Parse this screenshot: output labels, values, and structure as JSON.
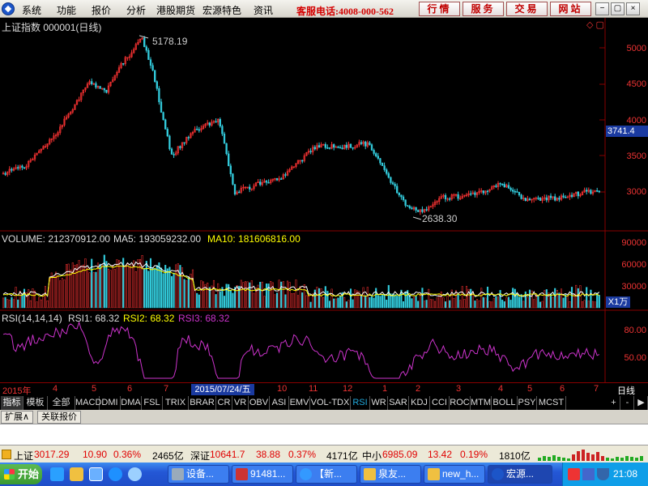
{
  "menu": {
    "items": [
      "系统",
      "功能",
      "报价",
      "分析",
      "港股期货",
      "宏源特色",
      "资讯"
    ],
    "hotline": "客服电话:4008-000-562",
    "buttons": [
      "行情",
      "服务",
      "交易",
      "网站"
    ],
    "window_controls": [
      "−",
      "▢",
      "×"
    ]
  },
  "main_chart": {
    "title": "上证指数 000001(日线)",
    "high_label": "5178.19",
    "low_label": "2638.30",
    "current_price_tag": "3741.4",
    "y_ticks": [
      "5000",
      "4500",
      "4000",
      "3500",
      "3000"
    ]
  },
  "volume_chart": {
    "label_volume": "VOLUME: 212370912.00",
    "label_ma5": "MA5: 193059232.00",
    "label_ma10": "MA10: 181606816.00",
    "y_ticks": [
      "90000",
      "60000",
      "30000"
    ],
    "unit": "X1万"
  },
  "rsi_chart": {
    "label_main": "RSI(14,14,14)",
    "label_rsi1": "RSI1: 68.32",
    "label_rsi2": "RSI2: 68.32",
    "label_rsi3": "RSI3: 68.32",
    "y_ticks": [
      "80.00",
      "50.00"
    ]
  },
  "time_axis": {
    "labels": [
      "2015年",
      "4",
      "5",
      "6",
      "7",
      "10",
      "11",
      "12",
      "1",
      "2",
      "3",
      "4",
      "5",
      "6",
      "7"
    ],
    "selected_date": "2015/07/24/五",
    "period": "日线"
  },
  "indicator_tabs": [
    "指标",
    "模板",
    "全部",
    "MACD",
    "DMI",
    "DMA",
    "FSL",
    "TRIX",
    "BRAR",
    "CR",
    "VR",
    "OBV",
    "ASI",
    "EMV",
    "VOL-TDX",
    "RSI",
    "WR",
    "SAR",
    "KDJ",
    "CCI",
    "ROC",
    "MTM",
    "BOLL",
    "PSY",
    "MCST"
  ],
  "tab_controls": [
    "+",
    "-",
    "▶"
  ],
  "expand_tabs": [
    "扩展∧",
    "关联报价"
  ],
  "status_bar": {
    "sh_name": "上证",
    "sh_value": "3017.29",
    "sh_change": "10.90",
    "sh_pct": "0.36%",
    "sh_amount": "2465亿",
    "sz_name": "深证",
    "sz_value": "10641.7",
    "sz_change": "38.88",
    "sz_pct": "0.37%",
    "sz_amount": "4171亿",
    "zx_name": "中小",
    "zx_value": "6985.09",
    "zx_change": "13.42",
    "zx_pct": "0.19%",
    "zx_amount": "1810亿"
  },
  "taskbar": {
    "start_label": "开始",
    "tasks": [
      "设备...",
      "91481...",
      "【新...",
      "泉友...",
      "new_h...",
      "宏源..."
    ],
    "clock": "21:08"
  },
  "colors": {
    "up": "#ff3333",
    "down": "#33ccdd",
    "ma5": "#ffffff",
    "ma10": "#ffff00",
    "rsi": "#cc33cc",
    "grid": "#880000"
  }
}
